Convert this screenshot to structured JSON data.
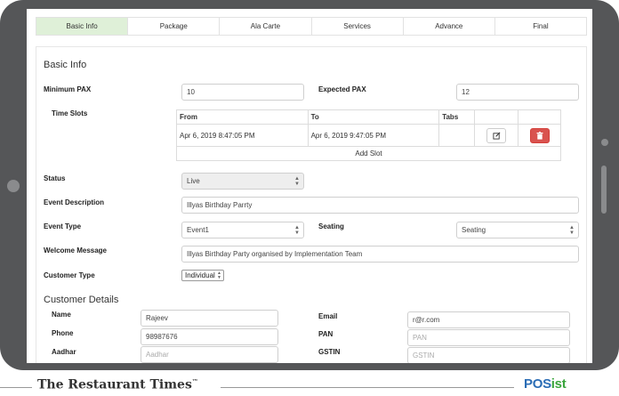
{
  "tabs": [
    {
      "label": "Basic Info",
      "active": true
    },
    {
      "label": "Package",
      "active": false
    },
    {
      "label": "Ala Carte",
      "active": false
    },
    {
      "label": "Services",
      "active": false
    },
    {
      "label": "Advance",
      "active": false
    },
    {
      "label": "Final",
      "active": false
    }
  ],
  "basic_info": {
    "title": "Basic Info",
    "min_pax_label": "Minimum PAX",
    "min_pax_value": "10",
    "expected_pax_label": "Expected PAX",
    "expected_pax_value": "12",
    "time_slots_label": "Time Slots",
    "slots_table": {
      "headers": [
        "From",
        "To",
        "Tabs"
      ],
      "rows": [
        {
          "from": "Apr 6, 2019 8:47:05 PM",
          "to": "Apr 6, 2019 9:47:05 PM",
          "tabs": ""
        }
      ],
      "add_slot_label": "Add Slot"
    },
    "status_label": "Status",
    "status_value": "Live",
    "event_description_label": "Event Description",
    "event_description_value": "Illyas Birthday Parrty",
    "event_type_label": "Event Type",
    "event_type_value": "Event1",
    "seating_label": "Seating",
    "seating_value": "Seating",
    "welcome_message_label": "Welcome Message",
    "welcome_message_value": "Illyas Birthday Party organised by Implementation Team",
    "customer_type_label": "Customer Type",
    "customer_type_value": "Individual"
  },
  "customer_details": {
    "title": "Customer Details",
    "name_label": "Name",
    "name_value": "Rajeev",
    "email_label": "Email",
    "email_value": "r@r.com",
    "phone_label": "Phone",
    "phone_value": "98987676",
    "pan_label": "PAN",
    "pan_placeholder": "PAN",
    "aadhar_label": "Aadhar",
    "aadhar_placeholder": "Aadhar",
    "gstin_label": "GSTIN",
    "gstin_placeholder": "GSTIN"
  },
  "footer": {
    "brand": "The Restaurant Times",
    "trademark": "™",
    "logo_main": "POS",
    "logo_accent": "ist"
  },
  "colors": {
    "active_tab": "#dff0d8",
    "delete_button": "#d9534f",
    "logo_blue": "#2b6db5",
    "logo_green": "#3aa53d"
  }
}
